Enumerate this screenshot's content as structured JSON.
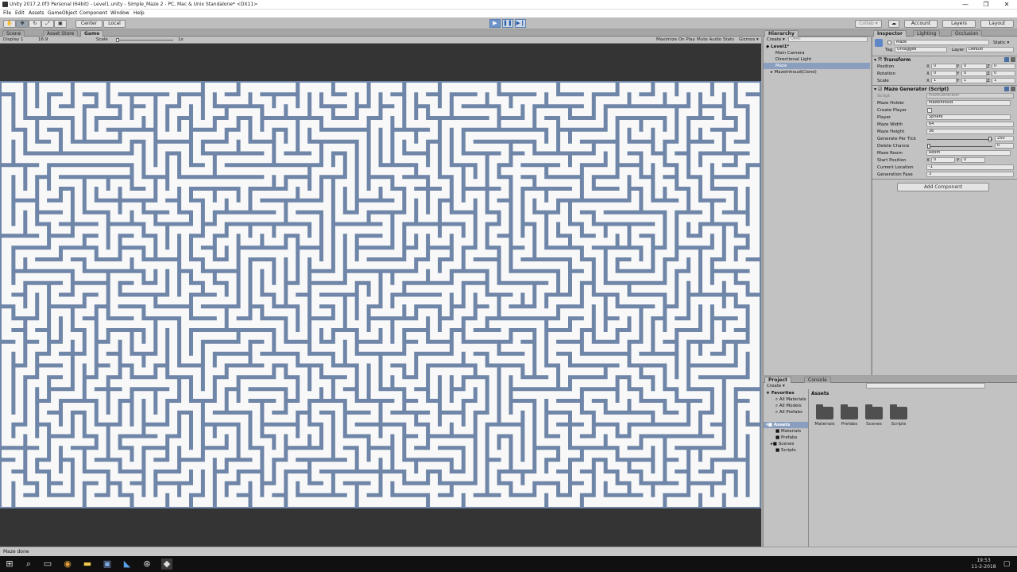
{
  "window": {
    "title": "Unity 2017.2.0f3 Personal (64bit) - Level1.unity - Simple_Maze 2 - PC, Mac & Unix Standalone* <DX11>",
    "minimize": "—",
    "maximize": "❐",
    "close": "✕"
  },
  "menu": [
    "File",
    "Edit",
    "Assets",
    "GameObject",
    "Component",
    "Window",
    "Help"
  ],
  "toolbar": {
    "pivot": "Center",
    "space": "Local",
    "collab": "Collab ▾",
    "account": "Account",
    "layers": "Layers",
    "layout": "Layout"
  },
  "tabs": {
    "scene": "Scene",
    "asset_store": "Asset Store",
    "game": "Game"
  },
  "gamebar": {
    "display": "Display 1",
    "aspect": "16:9",
    "scale_label": "Scale",
    "scale_value": "1x",
    "maximize_on_play": "Maximize On Play",
    "mute_audio": "Mute Audio",
    "stats": "Stats",
    "gizmos": "Gizmos ▾"
  },
  "hierarchy": {
    "tab": "Hierarchy",
    "create": "Create ▾",
    "search": "Q▾All",
    "scene": "Level1*",
    "items": [
      "Main Camera",
      "Directional Light",
      "Maze",
      "MazeInhoud(Clone)"
    ]
  },
  "inspector": {
    "tabs": [
      "Inspector",
      "Lighting",
      "Occlusion"
    ],
    "object_name": "Maze",
    "static_label": "Static ▾",
    "tag_label": "Tag",
    "tag_value": "Untagged",
    "layer_label": "Layer",
    "layer_value": "Default",
    "transform": {
      "title": "Transform",
      "position": {
        "label": "Position",
        "x": "0",
        "y": "0",
        "z": "0"
      },
      "rotation": {
        "label": "Rotation",
        "x": "0",
        "y": "0",
        "z": "0"
      },
      "scale": {
        "label": "Scale",
        "x": "1",
        "y": "1",
        "z": "1"
      }
    },
    "script": {
      "title": "Maze Generator (Script)",
      "script_label": "Script",
      "script_value": "MazeGenerator",
      "maze_holder_label": "Maze Holder",
      "maze_holder_value": "MazeInhoud",
      "create_player_label": "Create Player",
      "player_label": "Player",
      "player_value": "Sphere",
      "maze_width_label": "Maze Width",
      "maze_width_value": "64",
      "maze_height_label": "Maze Height",
      "maze_height_value": "36",
      "generate_per_tick_label": "Generate Per Tick",
      "generate_per_tick_value": "250",
      "generate_per_tick_fraction": 0.96,
      "delete_chance_label": "Delete Chance",
      "delete_chance_value": "0",
      "delete_chance_fraction": 0.0,
      "maze_room_label": "Maze Room",
      "maze_room_value": "Room",
      "start_position_label": "Start Position",
      "start_x": "0",
      "start_y": "0",
      "current_location_label": "Current Location",
      "current_location_value": "-1",
      "generation_fase_label": "Generation Fase",
      "generation_fase_value": "3"
    },
    "add_component": "Add Component"
  },
  "project": {
    "tabs": [
      "Project",
      "Console"
    ],
    "create": "Create ▾",
    "favorites": "Favorites",
    "favorite_items": [
      "All Materials",
      "All Models",
      "All Prefabs"
    ],
    "assets_root": "Assets",
    "asset_tree": [
      "Materials",
      "Prefabs",
      "Scenes",
      "Scripts"
    ],
    "assets_header": "Assets",
    "folders": [
      "Materials",
      "Prefabs",
      "Scenes",
      "Scripts"
    ]
  },
  "status": "Maze done",
  "taskbar": {
    "time": "19:53",
    "date": "11-2-2018"
  },
  "colors": {
    "maze_wall": "#6f86a8",
    "maze_floor": "#f8f8f8",
    "selection": "#8a9fbf"
  }
}
